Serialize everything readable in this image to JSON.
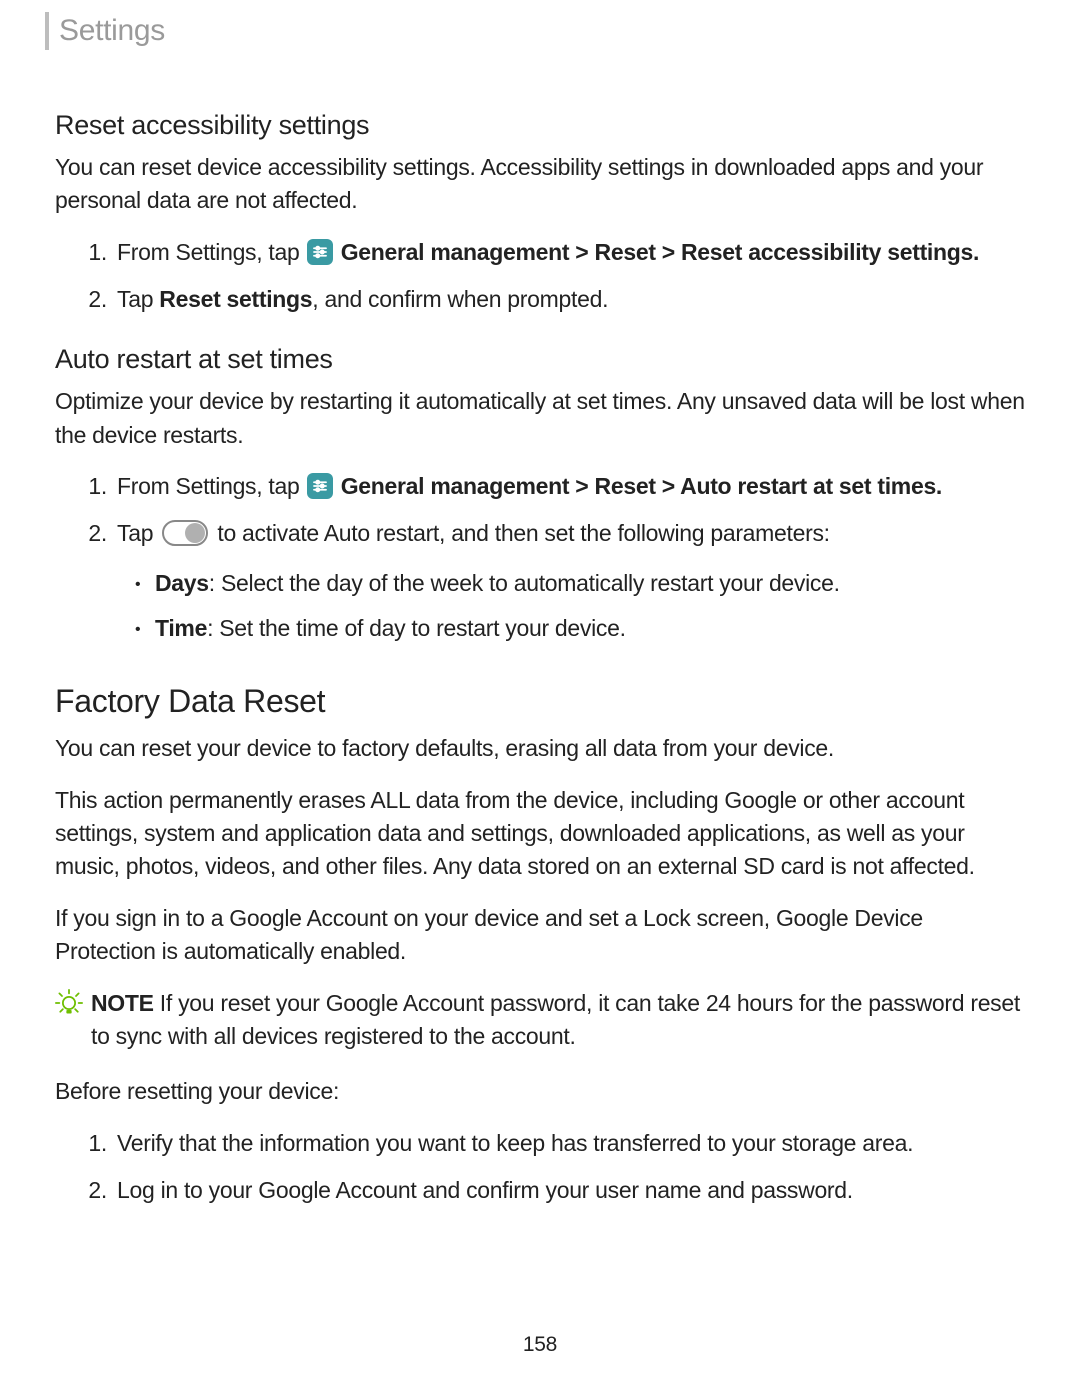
{
  "header": {
    "title": "Settings"
  },
  "s1": {
    "heading": "Reset accessibility settings",
    "intro": "You can reset device accessibility settings. Accessibility settings in downloaded apps and your personal data are not affected.",
    "step1_a": "From Settings, tap ",
    "step1_b": " General management > Reset > Reset accessibility settings.",
    "step2_a": "Tap ",
    "step2_b": "Reset settings",
    "step2_c": ", and confirm when prompted."
  },
  "s2": {
    "heading": "Auto restart at set times",
    "intro": "Optimize your device by restarting it automatically at set times. Any unsaved data will be lost when the device restarts.",
    "step1_a": "From Settings, tap ",
    "step1_b": " General management > Reset > Auto restart at set times.",
    "step2_a": "Tap ",
    "step2_b": " to activate Auto restart, and then set the following parameters:",
    "bullet1_label": "Days",
    "bullet1_text": ": Select the day of the week to automatically restart your device.",
    "bullet2_label": "Time",
    "bullet2_text": ": Set the time of day to restart your device."
  },
  "s3": {
    "heading": "Factory Data Reset",
    "p1": "You can reset your device to factory defaults, erasing all data from your device.",
    "p2": "This action permanently erases ALL data from the device, including Google or other account settings, system and application data and settings, downloaded applications, as well as your music, photos, videos, and other files. Any data stored on an external SD card is not affected.",
    "p3": "If you sign in to a Google Account on your device and set a Lock screen, Google Device Protection is automatically enabled.",
    "note_label": "NOTE",
    "note_text": "  If you reset your Google Account password, it can take 24 hours for the password reset to sync with all devices registered to the account.",
    "before": "Before resetting your device:",
    "b_step1": "Verify that the information you want to keep has transferred to your storage area.",
    "b_step2": "Log in to your Google Account and confirm your user name and password."
  },
  "page_number": "158"
}
